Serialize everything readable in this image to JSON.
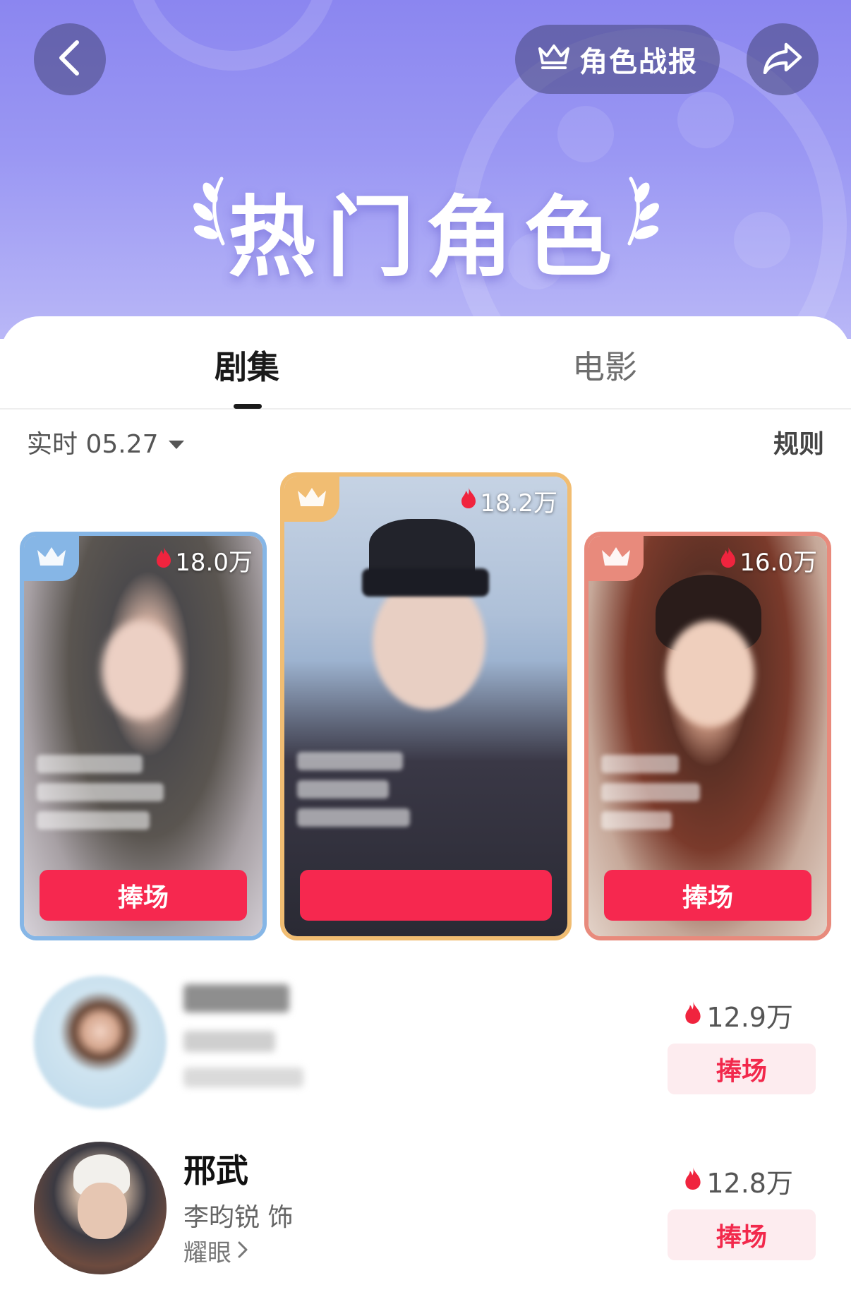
{
  "header": {
    "report_label": "角色战报",
    "banner_title": "热门角色",
    "colors": {
      "gradient_top": "#8b86f0",
      "gradient_bottom": "#b9b7f7"
    }
  },
  "tabs": [
    {
      "label": "剧集",
      "active": true
    },
    {
      "label": "电影",
      "active": false
    }
  ],
  "filter": {
    "date_label": "实时 05.27",
    "rules_label": "规则"
  },
  "podium": [
    {
      "rank": 2,
      "heat": "18.0万",
      "button": "捧场",
      "accent": "#86b6e6"
    },
    {
      "rank": 1,
      "heat": "18.2万",
      "button": "",
      "accent": "#f1bd72"
    },
    {
      "rank": 3,
      "heat": "16.0万",
      "button": "捧场",
      "accent": "#e88a7c"
    }
  ],
  "list": [
    {
      "rank": 4,
      "name": "",
      "actor": "",
      "show": "",
      "heat": "12.9万",
      "button": "捧场"
    },
    {
      "rank": 5,
      "name": "邢武",
      "actor": "李昀锐 饰",
      "show": "耀眼",
      "heat": "12.8万",
      "button": "捧场"
    }
  ],
  "icons": {
    "back": "chevron-left-icon",
    "crown": "crown-icon",
    "share": "share-arrow-icon",
    "flame": "flame-icon",
    "dropdown": "triangle-down-icon",
    "chevron_right": "chevron-right-icon"
  },
  "colors": {
    "cheer_red": "#f6284f",
    "cheer_soft_bg": "#fdecef",
    "flame_red": "#f0243e"
  }
}
